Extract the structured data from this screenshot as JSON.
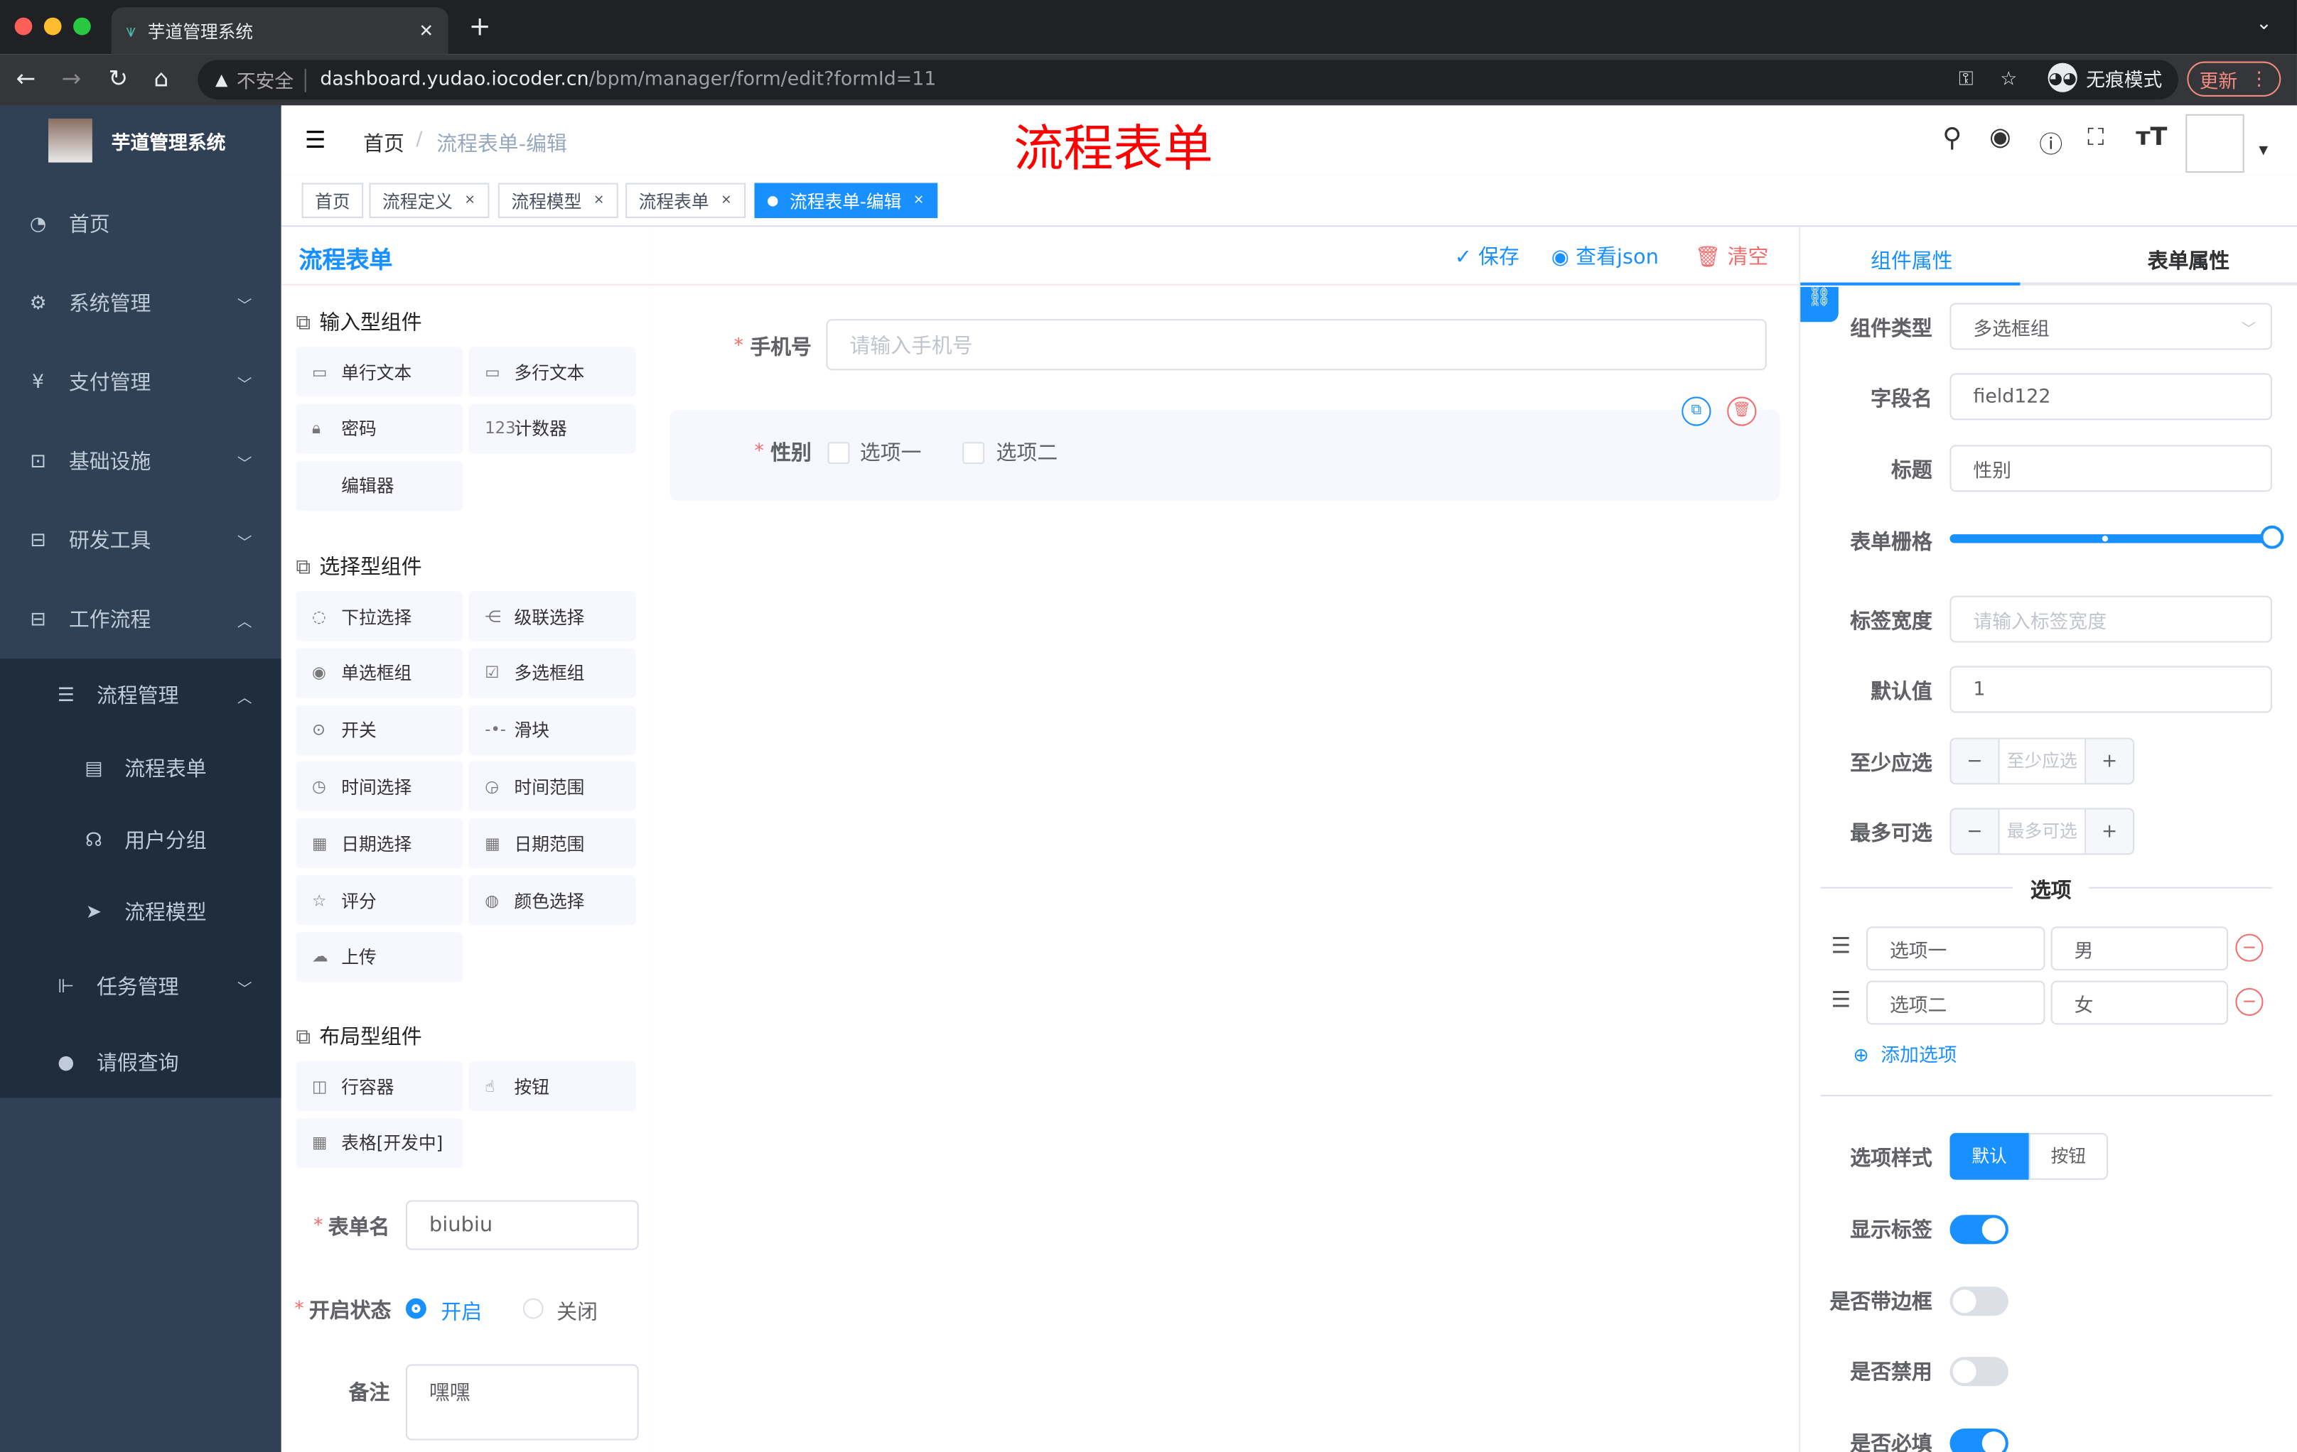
{
  "browser": {
    "tab_title": "芋道管理系统",
    "security": "不安全",
    "url_host": "dashboard.yudao.iocoder.cn",
    "url_path": "/bpm/manager/form/edit?formId=11",
    "incognito": "无痕模式",
    "update": "更新"
  },
  "sidebar": {
    "title": "芋道管理系统",
    "items": [
      {
        "label": "首页",
        "icon": "dashboard-icon"
      },
      {
        "label": "系统管理",
        "icon": "gear-icon",
        "chev": "down"
      },
      {
        "label": "支付管理",
        "icon": "yen-icon",
        "chev": "down"
      },
      {
        "label": "基础设施",
        "icon": "monitor-icon",
        "chev": "down"
      },
      {
        "label": "研发工具",
        "icon": "toolbox-icon",
        "chev": "down"
      },
      {
        "label": "工作流程",
        "icon": "toolbox-icon",
        "chev": "up"
      }
    ],
    "sub": [
      {
        "label": "流程管理",
        "icon": "list-icon",
        "chev": "up",
        "lvl": 1
      },
      {
        "label": "流程表单",
        "icon": "form-icon",
        "lvl": 2
      },
      {
        "label": "用户分组",
        "icon": "group-icon",
        "lvl": 2
      },
      {
        "label": "流程模型",
        "icon": "send-icon",
        "lvl": 2
      },
      {
        "label": "任务管理",
        "icon": "tree-icon",
        "chev": "down",
        "lvl": 1
      },
      {
        "label": "请假查询",
        "icon": "user-icon",
        "lvl": 1
      }
    ]
  },
  "navbar": {
    "breadcrumb_home": "首页",
    "breadcrumb_current": "流程表单-编辑",
    "big_title": "流程表单"
  },
  "tags": [
    {
      "label": "首页"
    },
    {
      "label": "流程定义",
      "close": "×"
    },
    {
      "label": "流程模型",
      "close": "×"
    },
    {
      "label": "流程表单",
      "close": "×"
    },
    {
      "label": "流程表单-编辑",
      "close": "×",
      "active": true
    }
  ],
  "left": {
    "title": "流程表单",
    "sections": [
      {
        "title": "输入型组件",
        "items": [
          {
            "icon": "▭",
            "label": "单行文本"
          },
          {
            "icon": "▭",
            "label": "多行文本"
          },
          {
            "icon": "🔒︎",
            "label": "密码"
          },
          {
            "icon": "123",
            "label": "计数器"
          },
          {
            "icon": "",
            "label": "编辑器"
          }
        ]
      },
      {
        "title": "选择型组件",
        "items": [
          {
            "icon": "◌",
            "label": "下拉选择"
          },
          {
            "icon": "⋲",
            "label": "级联选择"
          },
          {
            "icon": "◉",
            "label": "单选框组"
          },
          {
            "icon": "☑",
            "label": "多选框组"
          },
          {
            "icon": "⊙",
            "label": "开关"
          },
          {
            "icon": "-•-",
            "label": "滑块"
          },
          {
            "icon": "◷",
            "label": "时间选择"
          },
          {
            "icon": "◶",
            "label": "时间范围"
          },
          {
            "icon": "▦",
            "label": "日期选择"
          },
          {
            "icon": "▦",
            "label": "日期范围"
          },
          {
            "icon": "☆",
            "label": "评分"
          },
          {
            "icon": "◍",
            "label": "颜色选择"
          },
          {
            "icon": "☁",
            "label": "上传"
          }
        ]
      },
      {
        "title": "布局型组件",
        "items": [
          {
            "icon": "◫",
            "label": "行容器"
          },
          {
            "icon": "☝",
            "label": "按钮"
          },
          {
            "icon": "▦",
            "label": "表格[开发中]"
          }
        ]
      }
    ],
    "form_name_label": "表单名",
    "form_name": "biubiu",
    "status_label": "开启状态",
    "status_on": "开启",
    "status_off": "关闭",
    "remark_label": "备注",
    "remark": "嘿嘿"
  },
  "toolbar": {
    "save": "保存",
    "json": "查看json",
    "clear": "清空"
  },
  "canvas": {
    "phone_label": "手机号",
    "phone_placeholder": "请输入手机号",
    "gender_label": "性别",
    "opt1": "选项一",
    "opt2": "选项二"
  },
  "props": {
    "tab1": "组件属性",
    "tab2": "表单属性",
    "rows": [
      {
        "label": "组件类型",
        "value": "多选框组",
        "kind": "select"
      },
      {
        "label": "字段名",
        "value": "field122"
      },
      {
        "label": "标题",
        "value": "性别"
      },
      {
        "label": "表单栅格",
        "kind": "slider"
      },
      {
        "label": "标签宽度",
        "placeholder": "请输入标签宽度"
      },
      {
        "label": "默认值",
        "value": "1"
      },
      {
        "label": "至少应选",
        "placeholder": "至少应选",
        "kind": "num"
      },
      {
        "label": "最多可选",
        "placeholder": "最多可选",
        "kind": "num"
      }
    ],
    "slider_value": 24,
    "slider_max": 24,
    "options_title": "选项",
    "options": [
      {
        "label": "选项一",
        "value": "男"
      },
      {
        "label": "选项二",
        "value": "女"
      }
    ],
    "add_option": "添加选项",
    "style_label": "选项样式",
    "style_default": "默认",
    "style_button": "按钮",
    "switches": [
      {
        "label": "显示标签",
        "on": true
      },
      {
        "label": "是否带边框",
        "on": false
      },
      {
        "label": "是否禁用",
        "on": false
      },
      {
        "label": "是否必填",
        "on": true
      }
    ]
  },
  "colors": {
    "accent": "#1890ff",
    "sidebar": "#304156",
    "danger": "#f56c6c",
    "title_red": "#ff0000"
  }
}
